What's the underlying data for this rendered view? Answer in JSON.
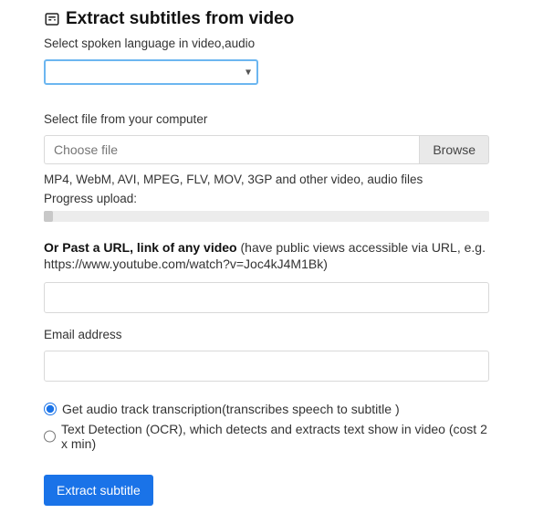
{
  "title": "Extract subtitles from video",
  "lang": {
    "label": "Select spoken language in video,audio",
    "selected": ""
  },
  "file": {
    "label": "Select file from your computer",
    "placeholder": "Choose file",
    "browse": "Browse",
    "formats_hint": "MP4, WebM, AVI, MPEG, FLV, MOV, 3GP and other video, audio files",
    "progress_label": "Progress upload:",
    "progress_pct": 2
  },
  "url": {
    "label_bold": "Or Past a URL, link of any video",
    "label_rest": " (have public views accessible via URL, e.g. https://www.youtube.com/watch?v=Joc4kJ4M1Bk)",
    "value": ""
  },
  "email": {
    "label": "Email address",
    "value": ""
  },
  "mode": {
    "audio_label": "Get audio track transcription(transcribes speech to subtitle )",
    "ocr_label": "Text Detection (OCR), which detects and extracts text show in video (cost 2 x min)",
    "selected": "audio"
  },
  "submit_label": "Extract subtitle"
}
